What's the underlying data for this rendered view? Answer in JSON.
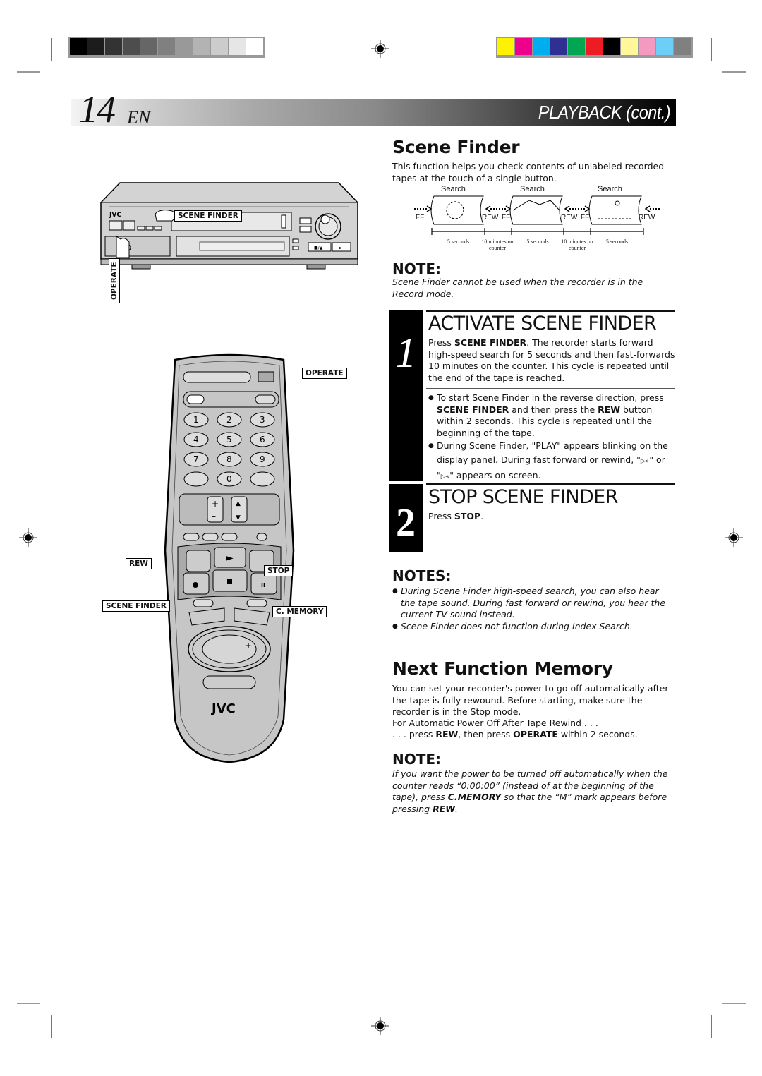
{
  "print_marks": {
    "gray_swatches": [
      "#000000",
      "#1c1c1c",
      "#333333",
      "#4d4d4d",
      "#666666",
      "#808080",
      "#999999",
      "#b3b3b3",
      "#cccccc",
      "#e6e6e6",
      "#ffffff"
    ],
    "color_swatches": [
      "#fff200",
      "#ec008c",
      "#00aeef",
      "#2e3192",
      "#00a651",
      "#ed1c24",
      "#000000",
      "#fff799",
      "#f49ac1",
      "#6dcff6",
      "#808080"
    ]
  },
  "header": {
    "page_number": "14",
    "language": "EN",
    "section": "PLAYBACK (cont.)"
  },
  "scene_finder": {
    "title": "Scene Finder",
    "intro": "This function helps you check contents of unlabeled recorded tapes at the touch of a single button.",
    "diagram": {
      "search_labels": [
        "Search",
        "Search",
        "Search"
      ],
      "direction_labels": [
        "FF",
        "REW",
        "FF",
        "REW",
        "FF",
        "REW"
      ],
      "intervals": [
        "5 seconds",
        "10 minutes on counter",
        "5 seconds",
        "10 minutes on counter",
        "5 seconds"
      ],
      "scenes": [
        "portrait-scene",
        "mountain-scene",
        "tennis-scene"
      ]
    },
    "note": {
      "heading": "NOTE:",
      "text": "Scene Finder cannot be used when the recorder is in the Record mode."
    },
    "step1": {
      "number": "1",
      "title": "ACTIVATE SCENE FINDER",
      "text_pre": "Press ",
      "text_bold": "SCENE FINDER",
      "text_post": ". The recorder starts forward high-speed search for 5 seconds and then fast-forwards 10 minutes on the counter. This cycle is repeated until the end of the tape is reached.",
      "bullet1_pre": "To start Scene Finder in the reverse direction, press ",
      "bullet1_bold1": "SCENE FINDER",
      "bullet1_mid": " and then press the ",
      "bullet1_bold2": "REW",
      "bullet1_post": " button within 2 seconds. This cycle is repeated until the beginning of the tape.",
      "bullet2_pre": "During Scene Finder, \"PLAY\" appears blinking on the display panel. During fast forward or rewind, \"",
      "bullet2_icon1": "▷»",
      "bullet2_mid": "\" or \"",
      "bullet2_icon2": "▷«",
      "bullet2_post": "\" appears on screen."
    },
    "step2": {
      "number": "2",
      "title": "STOP SCENE FINDER",
      "text_pre": "Press ",
      "text_bold": "STOP",
      "text_post": "."
    },
    "notes": {
      "heading": "NOTES:",
      "items": [
        "During Scene Finder high-speed search, you can also hear the tape sound. During fast forward or rewind, you hear the current TV sound instead.",
        "Scene Finder does not function during Index Search."
      ]
    }
  },
  "next_function_memory": {
    "title": "Next Function Memory",
    "para": "You can set your recorder's power to go off automatically after the tape is fully rewound. Before starting, make sure the recorder is in the Stop mode.",
    "line1": "For Automatic Power Off After Tape Rewind . . .",
    "line2_pre": ". . . press ",
    "line2_bold1": "REW",
    "line2_mid": ", then press ",
    "line2_bold2": "OPERATE",
    "line2_post": " within 2 seconds.",
    "note": {
      "heading": "NOTE:",
      "text_pre": "If you want the power to be turned off automatically when the counter reads “0:00:00” (instead of at the beginning of the tape), press ",
      "text_bold1": "C.MEMORY",
      "text_mid": " so that the “M” mark appears before pressing ",
      "text_bold2": "REW",
      "text_post": "."
    }
  },
  "vcr_illustration": {
    "brand": "JVC",
    "callouts": {
      "scene_finder": "SCENE FINDER",
      "operate": "OPERATE"
    },
    "panel_buttons": [
      "■/▲",
      "►"
    ]
  },
  "remote_illustration": {
    "brand": "JVC",
    "keypad": [
      "1",
      "2",
      "3",
      "4",
      "5",
      "6",
      "7",
      "8",
      "9",
      "",
      "0",
      ""
    ],
    "callouts": {
      "operate": "OPERATE",
      "rew": "REW",
      "stop": "STOP",
      "scene_finder": "SCENE FINDER",
      "c_memory": "C. MEMORY"
    }
  }
}
